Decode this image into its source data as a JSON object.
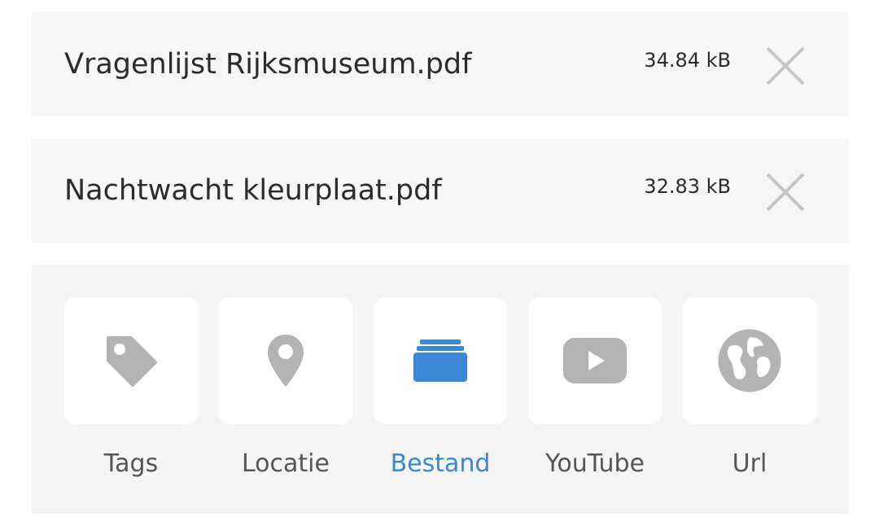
{
  "attachments": [
    {
      "name": "Vragenlijst Rijksmuseum.pdf",
      "size": "34.84 kB"
    },
    {
      "name": "Nachtwacht kleurplaat.pdf",
      "size": "32.83 kB"
    }
  ],
  "options": [
    {
      "label": "Tags",
      "icon": "tag-icon",
      "active": false
    },
    {
      "label": "Locatie",
      "icon": "map-pin-icon",
      "active": false
    },
    {
      "label": "Bestand",
      "icon": "folder-icon",
      "active": true
    },
    {
      "label": "YouTube",
      "icon": "youtube-icon",
      "active": false
    },
    {
      "label": "Url",
      "icon": "globe-icon",
      "active": false
    }
  ],
  "colors": {
    "card_background": "#f7f7f7",
    "panel_background": "#f5f5f5",
    "icon_inactive": "#b3b3b3",
    "accent": "#3a87d4",
    "text": "#2b2b2b",
    "label": "#555555"
  }
}
